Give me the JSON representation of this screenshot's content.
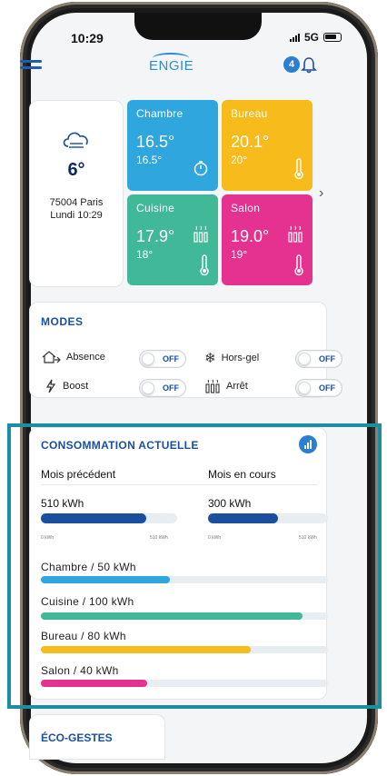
{
  "status_bar": {
    "time": "10:29",
    "network": "5G"
  },
  "header": {
    "logo": "ENGIE",
    "notification_count": "4"
  },
  "weather": {
    "temperature": "6°",
    "location": "75004 Paris",
    "datetime": "Lundi 10:29"
  },
  "rooms": [
    {
      "name": "Chambre",
      "current": "16.5°",
      "setpoint": "16.5°",
      "color": "#2fa6dd",
      "icon": "timer-icon"
    },
    {
      "name": "Bureau",
      "current": "20.1°",
      "setpoint": "20°",
      "color": "#f7bb1b",
      "icon": "thermometer-icon"
    },
    {
      "name": "Cuisine",
      "current": "17.9°",
      "setpoint": "18°",
      "color": "#41b897",
      "icon": "radiator-icon"
    },
    {
      "name": "Salon",
      "current": "19.0°",
      "setpoint": "19°",
      "color": "#e5318f",
      "icon": "radiator-icon"
    }
  ],
  "modes": {
    "title": "MODES",
    "items": [
      {
        "label": "Absence",
        "state": "OFF",
        "icon": "house-away-icon"
      },
      {
        "label": "Hors-gel",
        "state": "OFF",
        "icon": "snowflake-icon"
      },
      {
        "label": "Boost",
        "state": "OFF",
        "icon": "bolt-icon"
      },
      {
        "label": "Arrêt",
        "state": "OFF",
        "icon": "radiator-icon"
      }
    ]
  },
  "consommation": {
    "title": "CONSOMMATION ACTUELLE",
    "previous": {
      "label": "Mois précédent",
      "value": "510 kWh",
      "fraction": 0.77,
      "min": "0 kWh",
      "max": "510 kWh"
    },
    "current": {
      "label": "Mois en cours",
      "value": "300 kWh",
      "fraction": 0.58,
      "min": "0 kWh",
      "max": "510 kWh"
    },
    "rooms": [
      {
        "label": "Chambre  / 50 kWh",
        "fraction": 0.45,
        "color": "#2fa6dd"
      },
      {
        "label": "Cuisine  / 100 kWh",
        "fraction": 0.91,
        "color": "#41b897"
      },
      {
        "label": "Bureau  / 80 kWh",
        "fraction": 0.73,
        "color": "#f7bb1b"
      },
      {
        "label": "Salon  / 40 kWh",
        "fraction": 0.37,
        "color": "#e5318f"
      }
    ],
    "bar_color": "#1a4fa0"
  },
  "eco": {
    "title": "ÉCO-GESTES"
  }
}
